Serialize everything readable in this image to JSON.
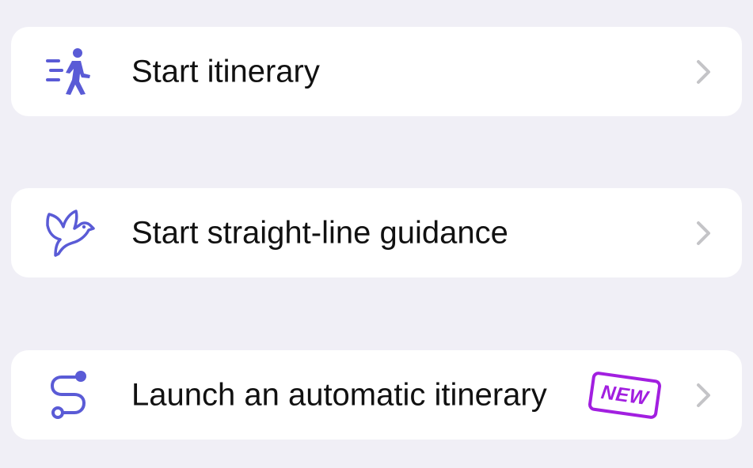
{
  "colors": {
    "background": "#f0eff6",
    "card": "#ffffff",
    "icon": "#5a5bd6",
    "chevron": "#c4c4c7",
    "badge": "#a21fe0"
  },
  "menu": {
    "items": [
      {
        "label": "Start itinerary",
        "icon": "walking-person-icon"
      },
      {
        "label": "Start straight-line guidance",
        "icon": "bird-icon"
      },
      {
        "label": "Launch an automatic itinerary",
        "icon": "route-path-icon",
        "badge": "NEW"
      }
    ]
  }
}
